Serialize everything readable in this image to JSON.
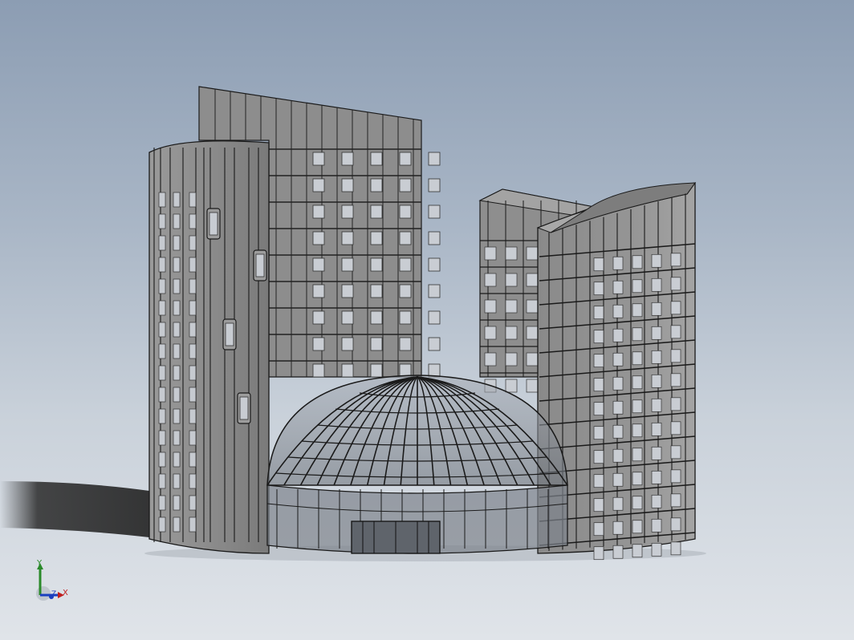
{
  "viewport": {
    "background_top": "#8c9db3",
    "background_bottom": "#e0e4e9",
    "model_color": "#8f8f8f",
    "edge_color": "#1a1a1a"
  },
  "triad": {
    "x_label": "X",
    "y_label": "Y",
    "z_label": "Z",
    "x_color": "#c02020",
    "y_color": "#2a8a2a",
    "z_color": "#1a3fbf"
  }
}
